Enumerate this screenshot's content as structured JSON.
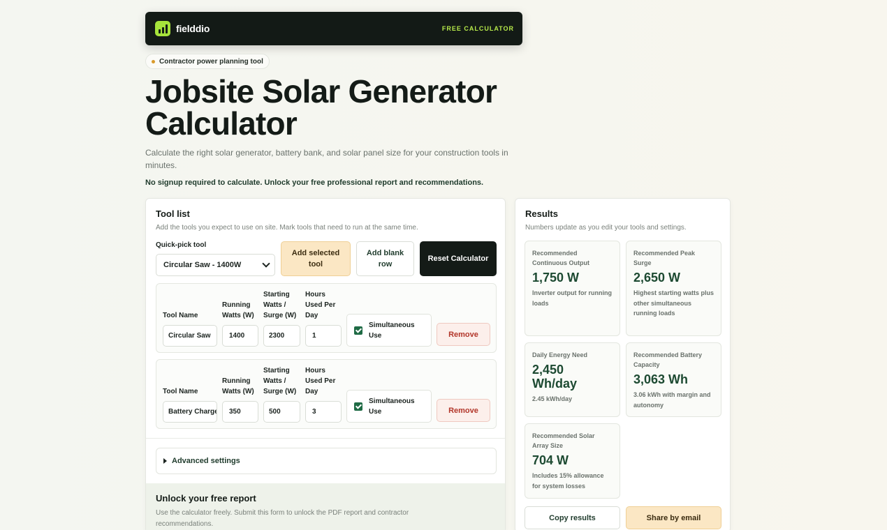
{
  "header": {
    "brand": "fielddio",
    "logo_icon": "bar-chart-icon",
    "tag": "FREE CALCULATOR"
  },
  "pill": "Contractor power planning tool",
  "title_line1": "Jobsite Solar Generator",
  "title_line2": "Calculator",
  "subtitle": "Calculate the right solar generator, battery bank, and solar panel size for your construction tools in minutes.",
  "no_signup": "No signup required to calculate. Unlock your free professional report and recommendations.",
  "tool_list": {
    "title": "Tool list",
    "subtitle": "Add the tools you expect to use on site. Mark tools that need to run at the same time.",
    "quick_pick_label": "Quick-pick tool",
    "quick_pick_value": "Circular Saw - 1400W",
    "add_selected_label": "Add selected tool",
    "add_blank_label": "Add blank row",
    "reset_label": "Reset Calculator",
    "columns": {
      "name": "Tool Name",
      "running": "Running Watts (W)",
      "starting": "Starting Watts / Surge (W)",
      "hours": "Hours Used Per Day"
    },
    "rows": [
      {
        "name": "Circular Saw",
        "running": "1400",
        "starting": "2300",
        "hours": "1",
        "simultaneous_label": "Simultaneous Use",
        "simultaneous": true,
        "remove_label": "Remove"
      },
      {
        "name": "Battery Charger",
        "running": "350",
        "starting": "500",
        "hours": "3",
        "simultaneous_label": "Simultaneous Use",
        "simultaneous": true,
        "remove_label": "Remove"
      }
    ],
    "advanced_label": "Advanced settings"
  },
  "unlock": {
    "title": "Unlock your free report",
    "subtitle": "Use the calculator freely. Submit this form to unlock the PDF report and contractor recommendations."
  },
  "results": {
    "title": "Results",
    "subtitle": "Numbers update as you edit your tools and settings.",
    "cards": [
      {
        "label": "Recommended Continuous Output",
        "value": "1,750 W",
        "note": "Inverter output for running loads"
      },
      {
        "label": "Recommended Peak Surge",
        "value": "2,650 W",
        "note": "Highest starting watts plus other simultaneous running loads"
      },
      {
        "label": "Daily Energy Need",
        "value": "2,450 Wh/day",
        "note": "2.45 kWh/day"
      },
      {
        "label": "Recommended Battery Capacity",
        "value": "3,063 Wh",
        "note": "3.06 kWh with margin and autonomy"
      },
      {
        "label": "Recommended Solar Array Size",
        "value": "704 W",
        "note": "Includes 15% allowance for system losses"
      }
    ],
    "copy_label": "Copy results",
    "share_label": "Share by email"
  },
  "colors": {
    "accent_green": "#a6e33b",
    "dark": "#131a16",
    "result_value": "#1d4a32",
    "amber_button": "#fbe7c4",
    "remove_red": "#b2362a"
  }
}
